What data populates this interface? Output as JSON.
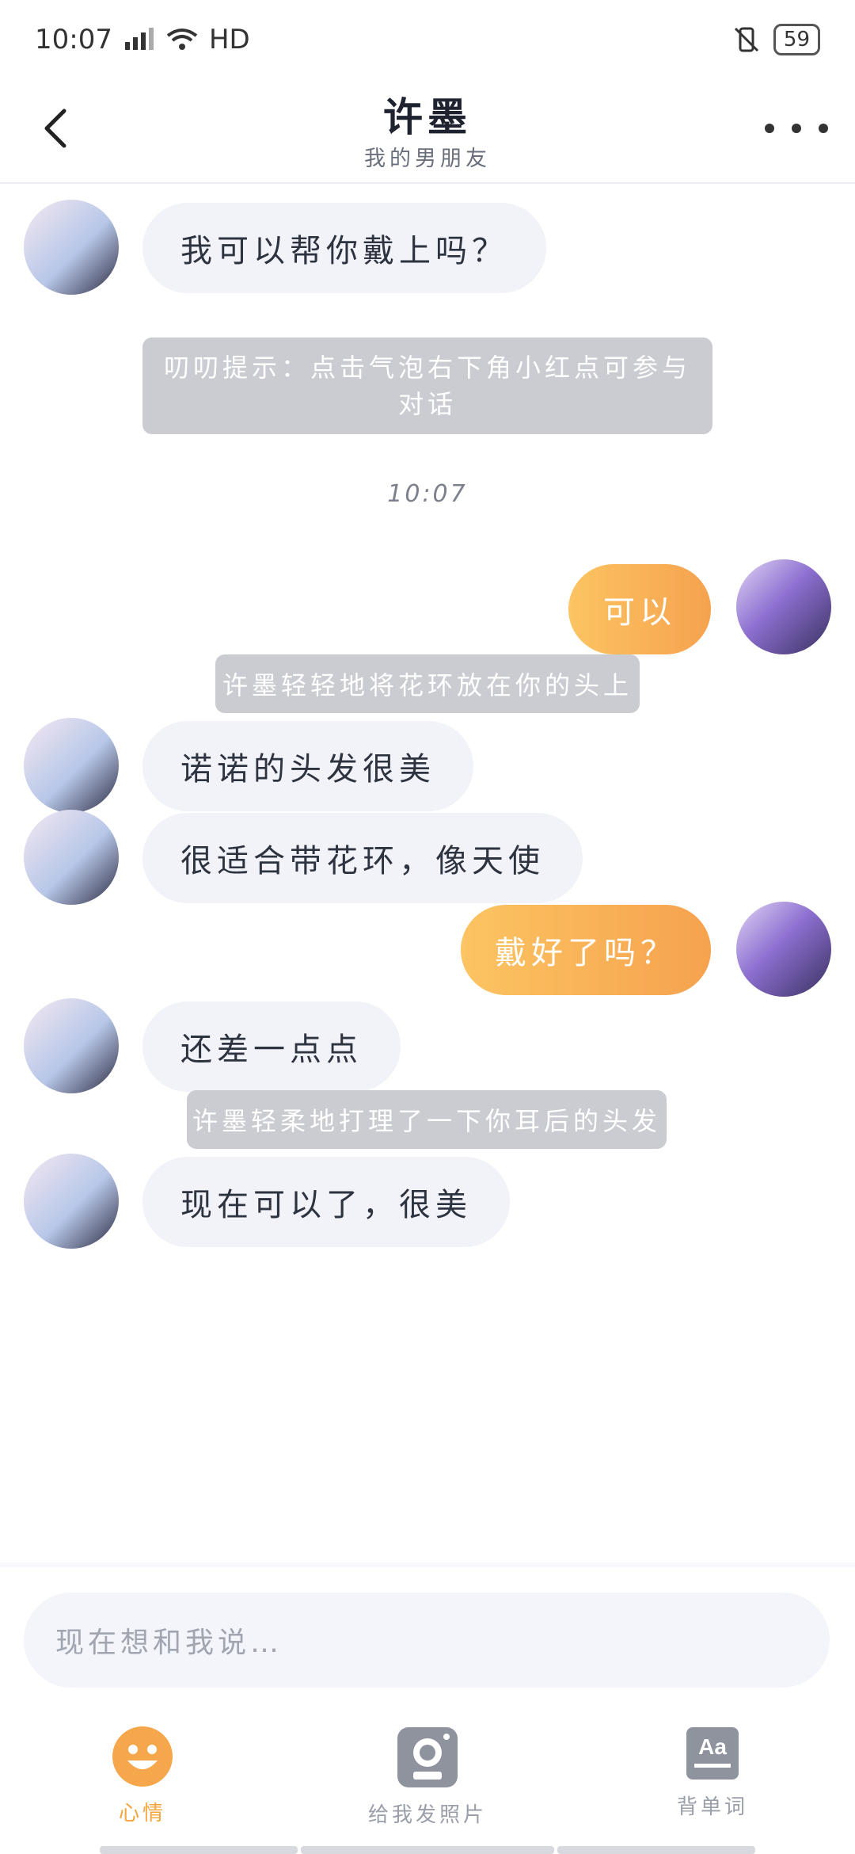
{
  "status_bar": {
    "time": "10:07",
    "network": "HD",
    "battery": "59"
  },
  "header": {
    "title": "许墨",
    "subtitle": "我的男朋友"
  },
  "messages": [
    {
      "type": "bot",
      "text": "我可以帮你戴上吗？"
    },
    {
      "type": "system",
      "text": "叨叨提示：点击气泡右下角小红点可参与对话"
    },
    {
      "type": "time",
      "text": "10:07"
    },
    {
      "type": "user",
      "text": "可以"
    },
    {
      "type": "system",
      "text": "许墨轻轻地将花环放在你的头上"
    },
    {
      "type": "bot",
      "text": "诺诺的头发很美"
    },
    {
      "type": "bot",
      "text": "很适合带花环，像天使"
    },
    {
      "type": "user",
      "text": "戴好了吗？"
    },
    {
      "type": "bot",
      "text": "还差一点点"
    },
    {
      "type": "system",
      "text": "许墨轻柔地打理了一下你耳后的头发"
    },
    {
      "type": "bot",
      "text": "现在可以了，很美"
    }
  ],
  "input": {
    "placeholder": "现在想和我说…"
  },
  "tabs": [
    {
      "label": "心情",
      "icon": "smiley-icon",
      "active": true
    },
    {
      "label": "给我发照片",
      "icon": "camera-icon",
      "active": false
    },
    {
      "label": "背单词",
      "icon": "dictionary-icon",
      "active": false
    }
  ],
  "colors": {
    "accent": "#f6a24e",
    "bot_bubble": "#f2f3f8",
    "system_bubble": "#cbccd2"
  }
}
